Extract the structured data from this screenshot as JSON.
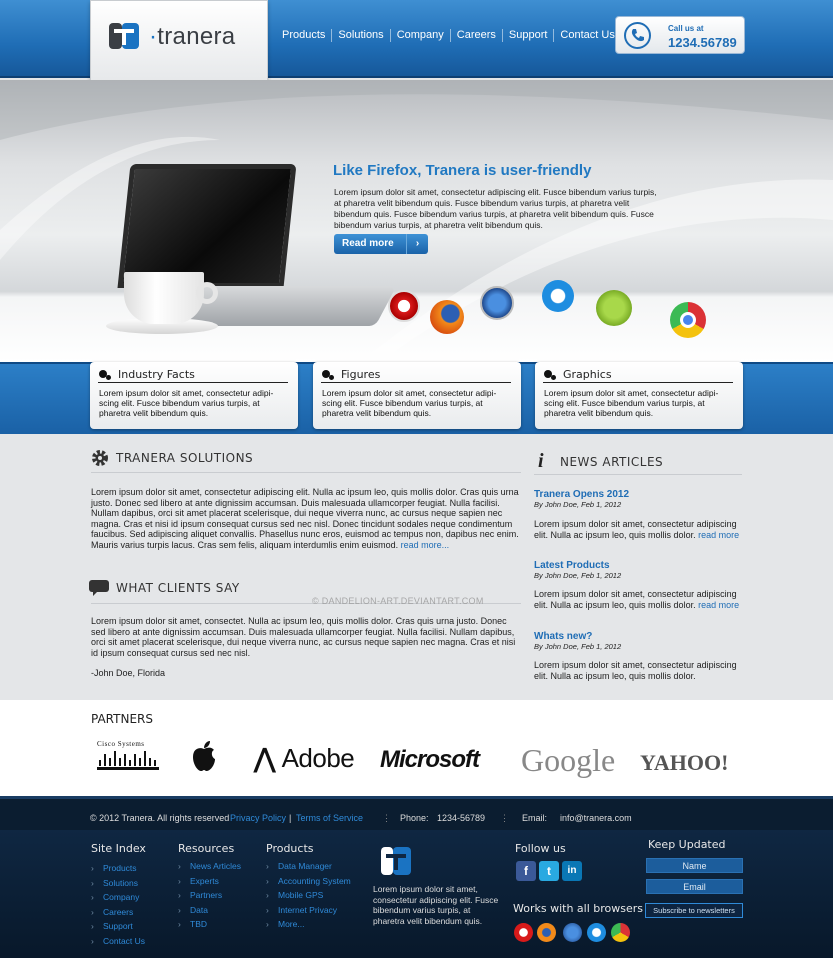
{
  "header": {
    "brand": "tranera",
    "nav": [
      "Products",
      "Solutions",
      "Company",
      "Careers",
      "Support",
      "Contact Us"
    ],
    "call_label": "Call us at",
    "call_number": "1234.56789"
  },
  "hero": {
    "title": "Like Firefox, Tranera is user-friendly",
    "text": "Lorem ipsum dolor sit amet, consectetur adipiscing elit. Fusce bibendum varius turpis, at pharetra velit bibendum quis. Fusce bibendum varius turpis, at pharetra velit bibendum quis. Fusce bibendum varius turpis, at pharetra velit bibendum quis. Fusce bibendum varius turpis, at pharetra velit bibendum quis.",
    "read_more": "Read more",
    "browsers": [
      "opera-icon",
      "firefox-icon",
      "safari-icon",
      "ie-icon",
      "android-icon",
      "chrome-icon"
    ]
  },
  "facts": [
    {
      "title": "Industry Facts",
      "text": "Lorem ipsum dolor sit amet, consectetur adipi-scing elit. Fusce bibendum varius turpis, at pharetra velit bibendum quis."
    },
    {
      "title": "Figures",
      "text": "Lorem ipsum dolor sit amet, consectetur adipi-scing elit. Fusce bibendum varius turpis, at pharetra velit bibendum quis."
    },
    {
      "title": "Graphics",
      "text": "Lorem ipsum dolor sit amet, consectetur adipi-scing elit. Fusce bibendum varius turpis, at pharetra velit bibendum quis."
    }
  ],
  "solutions": {
    "heading": "TRANERA SOLUTIONS",
    "text": "Lorem ipsum dolor sit amet, consectetur adipiscing elit. Nulla ac ipsum leo, quis mollis dolor. Cras quis urna justo. Donec sed libero at ante dignissim accumsan. Duis malesuada ullamcorper feugiat. Nulla facilisi. Nullam dapibus, orci sit amet placerat scelerisque, dui neque viverra nunc, ac cursus neque sapien nec magna. Cras et nisi id ipsum consequat cursus sed nec nisl. Donec tincidunt sodales neque condimentum faucibus. Sed adipiscing aliquet convallis. Phasellus nunc eros, euismod ac tempus non, dapibus nec enim. Mauris varius turpis lacus. Cras sem felis, aliquam interdumlis enim euismod.",
    "more": "read more..."
  },
  "clients": {
    "heading": "WHAT CLIENTS SAY",
    "text": "Lorem ipsum dolor sit amet, consectet. Nulla ac ipsum leo, quis mollis dolor. Cras quis urna justo. Donec sed libero at ante dignissim accumsan. Duis malesuada ullamcorper feugiat. Nulla facilisi. Nullam dapibus, orci sit amet placerat scelerisque, dui neque viverra nunc, ac cursus neque sapien nec magna. Cras et nisi id ipsum consequat cursus sed nec nisl.",
    "author": "-John Doe, Florida"
  },
  "news": {
    "heading": "NEWS ARTICLES",
    "items": [
      {
        "title": "Tranera Opens 2012",
        "by": "By John Doe, Feb 1, 2012",
        "text": "Lorem ipsum dolor sit amet, consectetur adipiscing elit. Nulla ac ipsum leo, quis mollis dolor.",
        "more": "read more"
      },
      {
        "title": "Latest Products",
        "by": "By John Doe, Feb 1, 2012",
        "text": "Lorem ipsum dolor sit amet, consectetur adipiscing elit. Nulla ac ipsum leo, quis mollis dolor.",
        "more": "read more"
      },
      {
        "title": "Whats new?",
        "by": "By John Doe, Feb 1, 2012",
        "text": "Lorem ipsum dolor sit amet, consectetur adipiscing elit. Nulla ac ipsum leo, quis mollis dolor.",
        "more": ""
      }
    ]
  },
  "watermark": "© DANDELION-ART.DEVIANTART.COM",
  "partners": {
    "heading": "PARTNERS",
    "logos": [
      "Cisco Systems",
      "Adobe",
      "Microsoft",
      "Google",
      "YAHOO!"
    ]
  },
  "footbar": {
    "copyright": "© 2012 Tranera. All rights reserved",
    "privacy": "Privacy Policy",
    "sep": "|",
    "terms": "Terms of Service",
    "phone_label": "Phone:",
    "phone": "1234-56789",
    "email_label": "Email:",
    "email": "info@tranera.com"
  },
  "footer": {
    "site_index": {
      "heading": "Site Index",
      "items": [
        "Products",
        "Solutions",
        "Company",
        "Careers",
        "Support",
        "Contact Us"
      ]
    },
    "resources": {
      "heading": "Resources",
      "items": [
        "News Articles",
        "Experts",
        "Partners",
        "Data",
        "TBD"
      ]
    },
    "products": {
      "heading": "Products",
      "items": [
        "Data Manager",
        "Accounting System",
        "Mobile GPS",
        "Internet Privacy",
        "More..."
      ]
    },
    "about_text": "Lorem ipsum dolor sit amet, consectetur adipiscing elit. Fusce bibendum varius turpis, at pharetra velit bibendum quis.",
    "follow_heading": "Follow us",
    "browsers_heading": "Works with all browsers",
    "keep_heading": "Keep Updated",
    "name_placeholder": "Name",
    "email_placeholder": "Email",
    "subscribe": "Subscribe to newsletters"
  },
  "colors": {
    "accent": "#1f6db5",
    "footer_bg": "#0b1d30",
    "link": "#2f8ad8"
  }
}
